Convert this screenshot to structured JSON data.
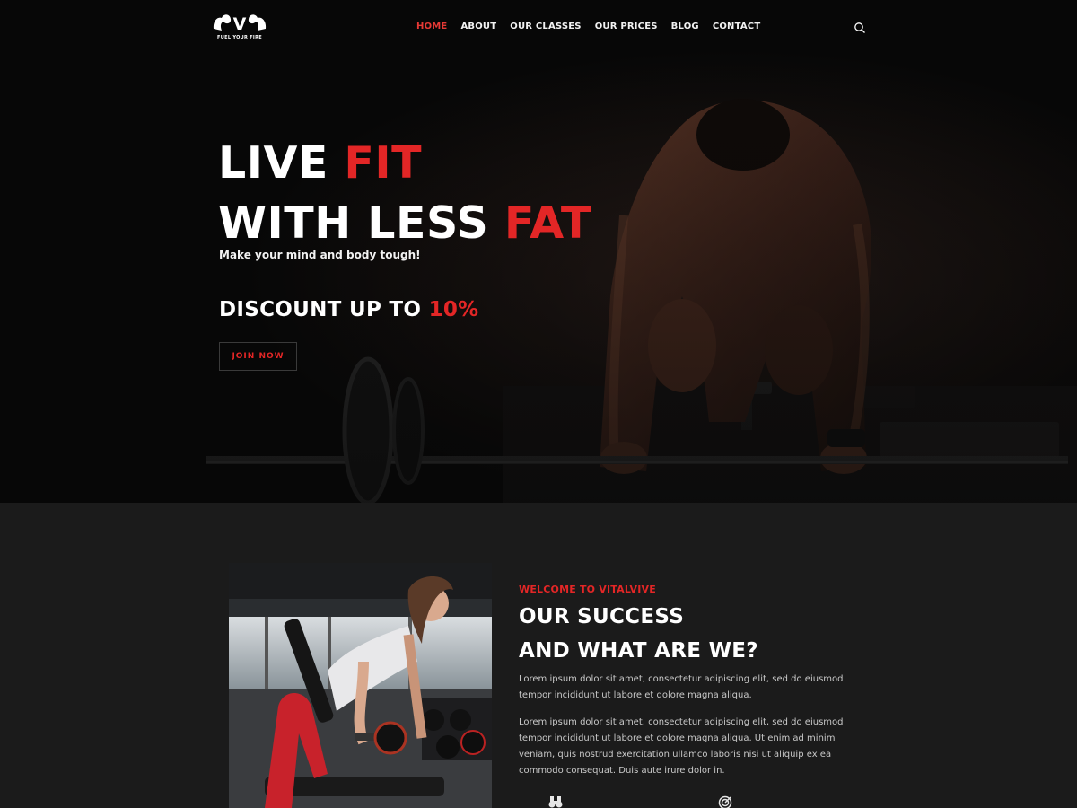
{
  "brand": {
    "logo_letter": "V",
    "tagline": "FUEL YOUR FIRE"
  },
  "nav": {
    "items": [
      "HOME",
      "ABOUT",
      "OUR CLASSES",
      "OUR PRICES",
      "BLOG",
      "CONTACT"
    ],
    "active": "HOME",
    "search_icon": "search-icon"
  },
  "hero": {
    "line1_white": "LIVE ",
    "line1_red": "FIT",
    "line2_white": "WITH LESS ",
    "line2_red": "FAT",
    "subtitle": "Make your mind and body tough!",
    "discount_white": "DISCOUNT UP TO ",
    "discount_red": "10%",
    "cta": "JOIN NOW"
  },
  "about": {
    "kicker": "WELCOME TO VITALVIVE",
    "title_line1": "OUR SUCCESS",
    "title_line2": "AND WHAT ARE WE?",
    "paragraph1": "Lorem ipsum dolor sit amet, consectetur adipiscing elit, sed do eiusmod tempor incididunt ut labore et dolore magna aliqua.",
    "paragraph2": " Lorem ipsum dolor sit amet, consectetur adipiscing elit, sed do eiusmod tempor incididunt ut labore et dolore magna aliqua. Ut enim ad minim veniam, quis nostrud exercitation ullamco laboris nisi ut aliquip ex ea commodo consequat. Duis aute irure dolor in.",
    "feature_icons": [
      "binoculars-icon",
      "target-icon"
    ]
  },
  "colors": {
    "accent": "#e32626",
    "hero_bg": "#070707",
    "section_bg": "#1b1b1b"
  }
}
